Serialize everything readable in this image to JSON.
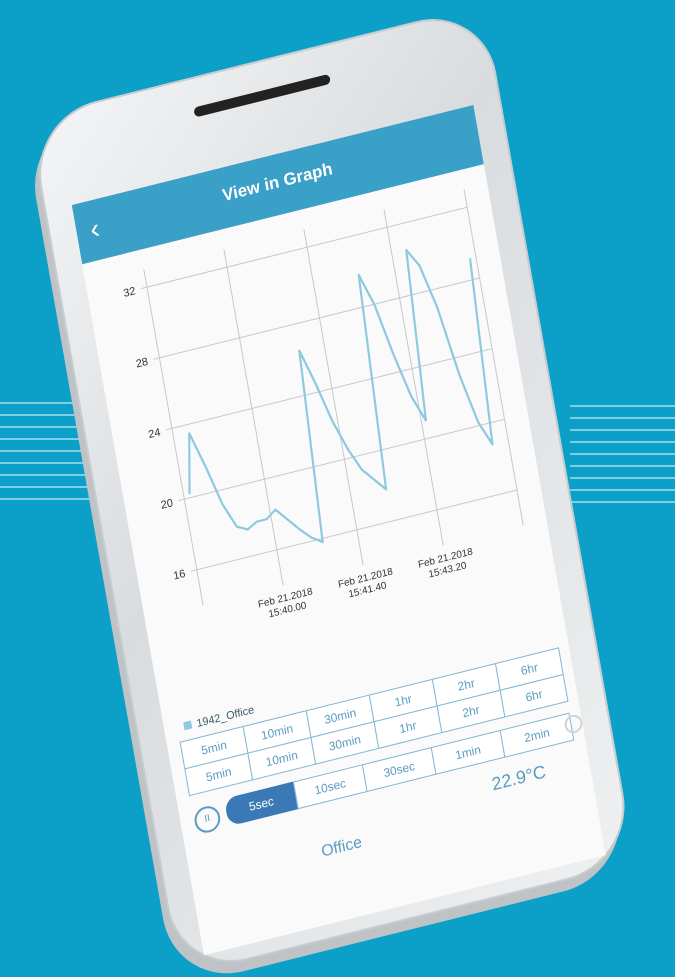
{
  "header": {
    "title": "View in Graph",
    "back_icon": "chevron-left-icon"
  },
  "chart_data": {
    "type": "line",
    "y_ticks": [
      "32",
      "28",
      "24",
      "20",
      "16"
    ],
    "ylim": [
      14,
      33
    ],
    "x_ticks": [
      {
        "date": "Feb 21.2018",
        "time": "15:40.00"
      },
      {
        "date": "Feb 21.2018",
        "time": "15:41.40"
      },
      {
        "date": "Feb 21.2018",
        "time": "15:43.20"
      }
    ],
    "series": [
      {
        "name": "1942_Office",
        "color": "#8fc9e0",
        "values": [
          20.2,
          23.5,
          21.5,
          19.2,
          17.8,
          17.5,
          17.8,
          17.8,
          18.2,
          17.5,
          16.8,
          16.2,
          15.8,
          26.5,
          24.5,
          22.2,
          20.5,
          19.2,
          18.5,
          17.8,
          29.8,
          28.0,
          25.0,
          22.5,
          21.0,
          30.5,
          29.5,
          27.0,
          23.0,
          20.2,
          18.8,
          29.2
        ]
      }
    ]
  },
  "legend": {
    "label": "1942_Office"
  },
  "ranges": {
    "row1": [
      "5min",
      "10min",
      "30min",
      "1hr",
      "2hr",
      "6hr"
    ],
    "row2": [
      "5min",
      "10min",
      "30min",
      "1hr",
      "2hr",
      "6hr"
    ],
    "row3": [
      "5sec",
      "10sec",
      "30sec",
      "1min",
      "2min"
    ]
  },
  "controls": {
    "pause_icon": "pause-icon",
    "selected": "5sec"
  },
  "reading": {
    "temp": "22.9°C",
    "location": "Office"
  }
}
